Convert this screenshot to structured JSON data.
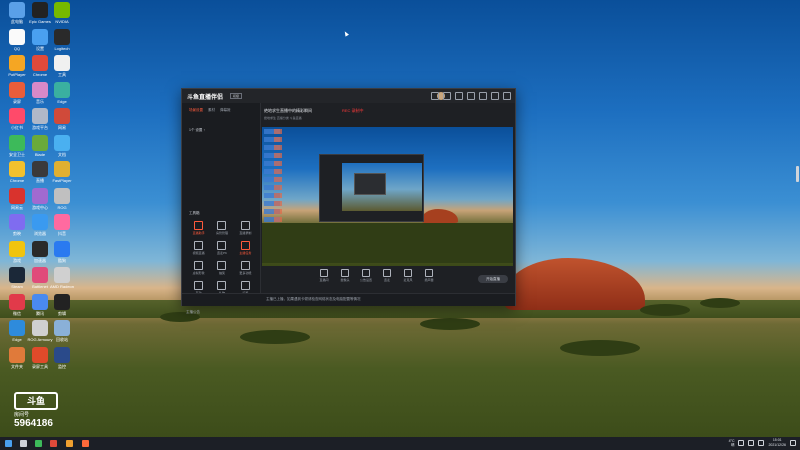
{
  "desktop": {
    "icons": [
      {
        "label": "此电脑",
        "color": "#5aa0e8"
      },
      {
        "label": "QQ",
        "color": "#fafafa"
      },
      {
        "label": "PotPlayer",
        "color": "#f5a623"
      },
      {
        "label": "录屏",
        "color": "#e85d3a"
      },
      {
        "label": "小红书",
        "color": "#ff4a6a"
      },
      {
        "label": "安全卫士",
        "color": "#3dba5a"
      },
      {
        "label": "Chrome",
        "color": "#f2c12e"
      },
      {
        "label": "网易云",
        "color": "#d9332d"
      },
      {
        "label": "剪映",
        "color": "#7f6cf0"
      },
      {
        "label": "游戏",
        "color": "#f1c40f"
      },
      {
        "label": "Steam",
        "color": "#1b2838"
      },
      {
        "label": "微信",
        "color": "#e13a4a"
      },
      {
        "label": "Edge",
        "color": "#2e8bdc"
      },
      {
        "label": "文件夹",
        "color": "#e07a3a"
      },
      {
        "label": "Epic Games",
        "color": "#222222"
      },
      {
        "label": "设置",
        "color": "#4aa0f0"
      },
      {
        "label": "Chrome",
        "color": "#e04a3a"
      },
      {
        "label": "音乐",
        "color": "#d889c8"
      },
      {
        "label": "游戏平台",
        "color": "#b0b8c8"
      },
      {
        "label": "Blade",
        "color": "#6aaa3a"
      },
      {
        "label": "直播",
        "color": "#3a3a3a"
      },
      {
        "label": "游戏中心",
        "color": "#a06ad0"
      },
      {
        "label": "浏览器",
        "color": "#3a9af0"
      },
      {
        "label": "加速器",
        "color": "#2a2a2a"
      },
      {
        "label": "Battlenet",
        "color": "#e04a7a"
      },
      {
        "label": "腾讯",
        "color": "#4a8af0"
      },
      {
        "label": "ROG Armoury",
        "color": "#d0d0d0"
      },
      {
        "label": "录屏工具",
        "color": "#e04a2a"
      },
      {
        "label": "NVIDIA",
        "color": "#76b900"
      },
      {
        "label": "Logitech",
        "color": "#2a2a2a"
      },
      {
        "label": "工具",
        "color": "#f0f0f0"
      },
      {
        "label": "Edge",
        "color": "#3ab0a0"
      },
      {
        "label": "网易",
        "color": "#d04a3a"
      },
      {
        "label": "文档",
        "color": "#4ab0f0"
      },
      {
        "label": "FastPlayer",
        "color": "#e0b030"
      },
      {
        "label": "ROG",
        "color": "#c0c0c0"
      },
      {
        "label": "抖音",
        "color": "#ff6aa0"
      },
      {
        "label": "酷狗",
        "color": "#2a7af0"
      },
      {
        "label": "AMD Radeon",
        "color": "#d0d0d0"
      },
      {
        "label": "剪辑",
        "color": "#222222"
      },
      {
        "label": "回收站",
        "color": "#8ab0d8"
      },
      {
        "label": "监控",
        "color": "#2a4a8a"
      }
    ]
  },
  "app": {
    "logo_text": "斗鱼直播伴侣",
    "version_tag": "初级",
    "title_icons": [
      "skin-icon",
      "mail-icon",
      "download-icon",
      "menu-icon",
      "minimize-icon",
      "maximize-icon",
      "close-icon"
    ],
    "tabs": [
      "场景设置",
      "素材",
      "弹幕姬"
    ],
    "guest_label": "1个  设置 ↑",
    "room_title": "绝地求生直播中的精彩瞬间",
    "room_status": "REC 录制中",
    "room_tags": "绝地求生  直播分类  斗鱼直播",
    "preview_header_icons": [
      "record-icon",
      "screenshot-icon",
      "fullscreen-icon",
      "settings-icon",
      "share-icon"
    ],
    "tool_section_title": "工具箱",
    "tools": [
      {
        "label": "直播助手",
        "icon": "assistant-icon",
        "active": true
      },
      {
        "label": "房管管理",
        "icon": "admin-icon",
        "active": false
      },
      {
        "label": "直播录制",
        "icon": "record-icon",
        "active": false
      },
      {
        "label": "视频直播",
        "icon": "video-icon",
        "active": false
      },
      {
        "label": "连麦PK",
        "icon": "pk-icon",
        "active": false
      },
      {
        "label": "主播任务",
        "icon": "task-icon",
        "active": true
      },
      {
        "label": "虚拟形象",
        "icon": "avatar-icon",
        "active": false
      },
      {
        "label": "抽奖",
        "icon": "lottery-icon",
        "active": false
      },
      {
        "label": "更多功能",
        "icon": "more-icon",
        "active": false
      },
      {
        "label": "互动",
        "icon": "interact-icon",
        "active": false
      },
      {
        "label": "礼物",
        "icon": "gift-icon",
        "active": false
      },
      {
        "label": "设置",
        "icon": "settings-icon",
        "active": false
      }
    ],
    "controls": [
      {
        "label": "直播间",
        "icon": "room-icon"
      },
      {
        "label": "摄像头",
        "icon": "camera-icon"
      },
      {
        "label": "公告设置",
        "icon": "notice-icon"
      },
      {
        "label": "连麦",
        "icon": "mic-link-icon"
      },
      {
        "label": "麦克风",
        "icon": "mic-icon"
      },
      {
        "label": "扬声器",
        "icon": "speaker-icon"
      }
    ],
    "start_button": "开始直播",
    "status_left": "主播公告",
    "status_text": "主播已上播，如果遇到卡顿请检查网络状态及电脑配置等情况",
    "accent": "#ff5a3c"
  },
  "watermark": {
    "logo": "斗鱼",
    "sub": "房间号",
    "room_number": "5964186"
  },
  "taskbar": {
    "apps": [
      {
        "name": "start-icon",
        "color": "#4aa0f0"
      },
      {
        "name": "search-icon",
        "color": "#cfd3da"
      },
      {
        "name": "app-icon-1",
        "color": "#3dba5a"
      },
      {
        "name": "app-icon-2",
        "color": "#e04a3a"
      },
      {
        "name": "app-icon-3",
        "color": "#f0a030"
      },
      {
        "name": "douyu-icon",
        "color": "#ff6a3a"
      }
    ],
    "weather": "4°C",
    "weather_sub": "晴",
    "time": "15:01",
    "date": "2021/12/26"
  }
}
